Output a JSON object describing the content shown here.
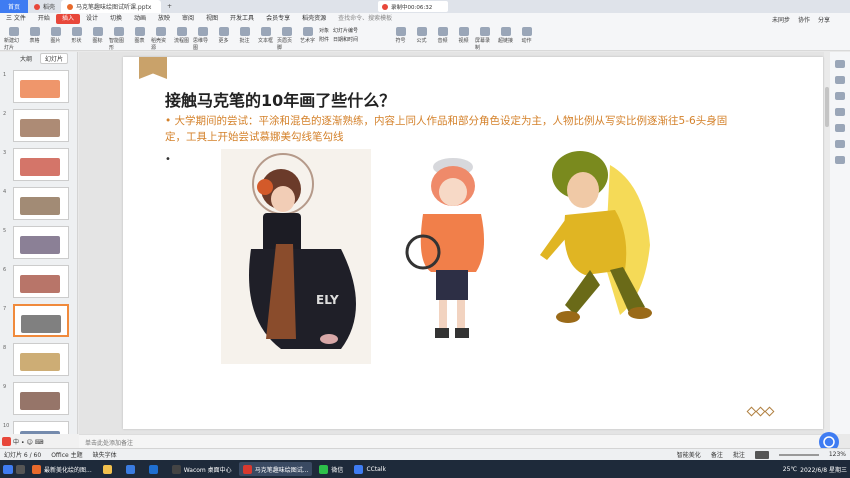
{
  "titlebar": {
    "tabs": [
      {
        "label": "首页"
      },
      {
        "label": "稻壳"
      },
      {
        "label": "马克笔趣味绘图试听课.pptx"
      }
    ],
    "timer": "录制中00:06:32"
  },
  "menubar": {
    "items": [
      "三 文件",
      "开始",
      "插入",
      "设计",
      "切换",
      "动画",
      "放映",
      "审阅",
      "视图",
      "开发工具",
      "会员专享",
      "稻壳资源"
    ],
    "active": "插入",
    "search_placeholder": "查找命令、搜索模板",
    "right": [
      "未同步",
      "协作",
      "分享"
    ]
  },
  "ribbon": {
    "buttons": [
      "新建幻灯片",
      "表格",
      "图片",
      "形状",
      "图标",
      "智能图形",
      "图表",
      "稻壳资源",
      "流程图",
      "思维导图",
      "更多",
      "批注",
      "文本框",
      "页眉页脚",
      "艺术字",
      "符号",
      "公式",
      "音频",
      "视频",
      "屏幕录制",
      "超链接",
      "动作"
    ],
    "small": [
      "对象",
      "幻灯片编号",
      "附件",
      "日期和时间"
    ]
  },
  "leftpane": {
    "tabs": [
      "大纲",
      "幻灯片"
    ],
    "slide_numbers": [
      "1",
      "2",
      "3",
      "4",
      "5",
      "6",
      "7",
      "8",
      "9",
      "10"
    ],
    "selected_index": 6
  },
  "slide": {
    "title": "接触马克笔的10年画了些什么？",
    "bullet1": "大学期间的尝试：平涂和混色的逐渐熟练，内容上同人作品和部分角色设定为主，人物比例从写实比例逐渐往5-6头身固定，工具上开始尝试慕娜美勾线笔勾线",
    "bullet_marker": "•",
    "bullet2_marker": "•"
  },
  "notes": {
    "placeholder": "单击此处添加备注"
  },
  "statusbar": {
    "left": [
      "幻灯片 6 / 60",
      "Office 主题",
      "缺失字体"
    ],
    "right": [
      "智能美化",
      "备注",
      "批注",
      "123%"
    ]
  },
  "taskbar": {
    "items": [
      {
        "label": "最新美化绘的图...",
        "color": "#e86a2c"
      },
      {
        "label": "",
        "color": "#f2c14e"
      },
      {
        "label": "",
        "color": "#3a7be0"
      },
      {
        "label": "",
        "color": "#1f6fd1"
      },
      {
        "label": "Wacom 桌面中心",
        "color": "#444"
      },
      {
        "label": "马克笔趣味绘图试...",
        "color": "#d9392f"
      },
      {
        "label": "微信",
        "color": "#2dc04a"
      },
      {
        "label": "CCtalk",
        "color": "#3f7cf2"
      }
    ],
    "weather": "25℃",
    "clock": "2022/6/8 星期三"
  },
  "colors": {
    "accent": "#e8473a",
    "bullet": "#d4812a",
    "selected_thumb": "#f08a3c"
  }
}
